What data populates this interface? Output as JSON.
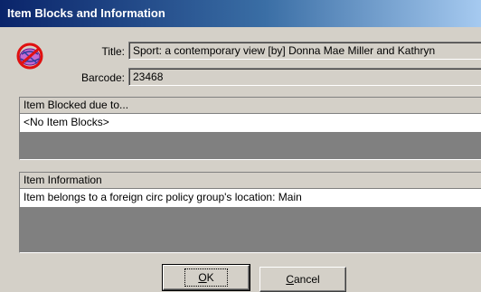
{
  "window": {
    "title": "Item Blocks and Information"
  },
  "form": {
    "title_label": "Title:",
    "title_value": "Sport: a contemporary view [by] Donna Mae Miller and Kathryn",
    "barcode_label": "Barcode:",
    "barcode_value": "23468"
  },
  "blocks_panel": {
    "header": "Item Blocked due to...",
    "rows": [
      "<No Item Blocks>"
    ]
  },
  "info_panel": {
    "header": "Item Information",
    "rows": [
      "Item belongs to a foreign circ policy group's location:  Main"
    ]
  },
  "buttons": {
    "ok": {
      "mnemonic": "O",
      "rest": "K"
    },
    "cancel": {
      "mnemonic": "C",
      "rest": "ancel"
    }
  },
  "icons": {
    "app": "no-entry-globe-icon"
  }
}
